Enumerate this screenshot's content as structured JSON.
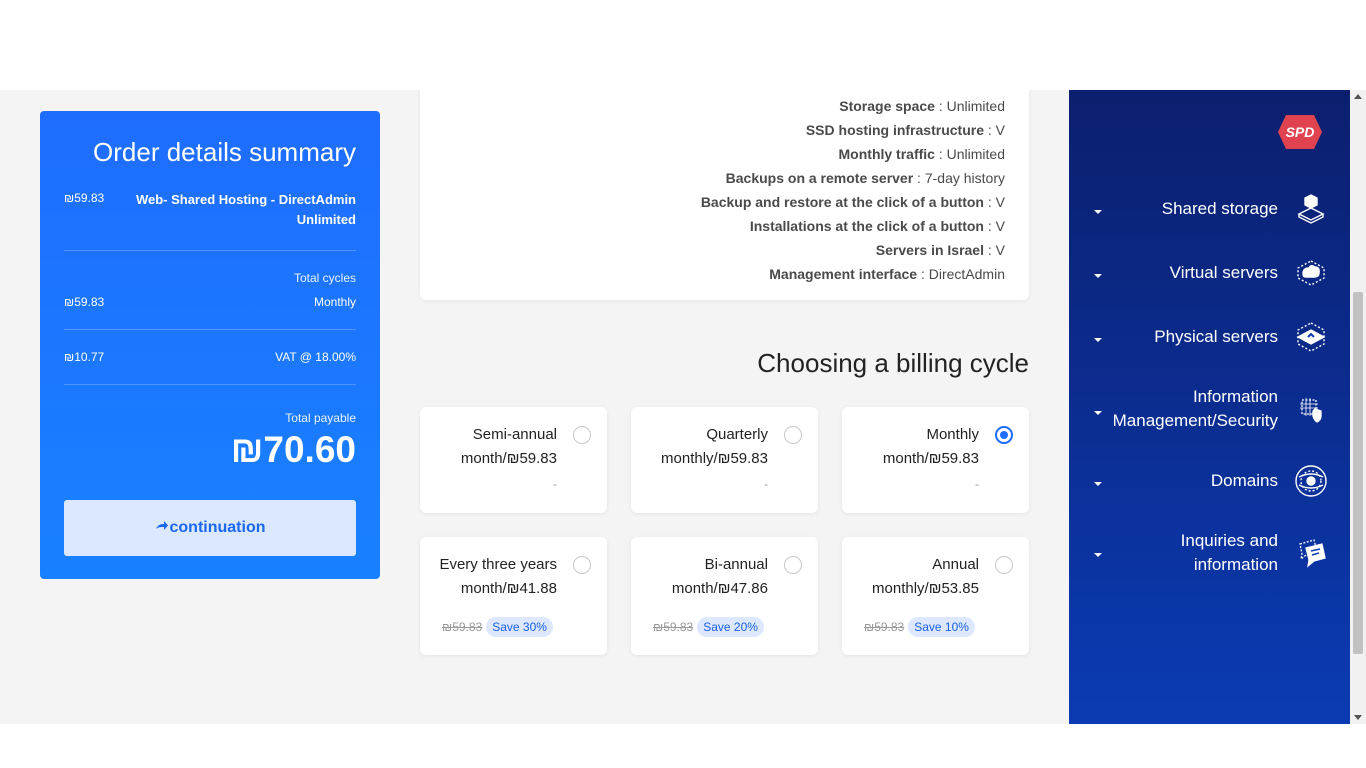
{
  "summary": {
    "title": "Order details summary",
    "item_price": "₪59.83",
    "item_name": "Web- Shared Hosting - DirectAdmin Unlimited",
    "cycles_label": "Total cycles",
    "cycle_price": "₪59.83",
    "cycle_value": "Monthly",
    "vat_amount": "₪10.77",
    "vat_label": "VAT @ 18.00%",
    "total_label": "Total payable",
    "total_value": "₪70.60",
    "continue_label": "continuation"
  },
  "features": [
    {
      "name": "Storage space",
      "value": " : Unlimited"
    },
    {
      "name": "SSD hosting infrastructure",
      "value": " : V"
    },
    {
      "name": "Monthly traffic",
      "value": " : Unlimited"
    },
    {
      "name": "Backups on a remote server",
      "value": " : 7-day history"
    },
    {
      "name": "Backup and restore at the click of a button",
      "value": " : V"
    },
    {
      "name": "Installations at the click of a button",
      "value": " : V"
    },
    {
      "name": "Servers in Israel",
      "value": " : V"
    },
    {
      "name": "Management interface",
      "value": " : DirectAdmin"
    }
  ],
  "billing": {
    "title": "Choosing a billing cycle",
    "plans": [
      {
        "name": "Semi-annual",
        "price": "month/₪59.83",
        "dash": "-",
        "selected": false
      },
      {
        "name": "Quarterly",
        "price": "monthly/₪59.83",
        "dash": "-",
        "selected": false
      },
      {
        "name": "Monthly",
        "price": "month/₪59.83",
        "dash": "-",
        "selected": true
      },
      {
        "name": "Every three years",
        "price": "month/₪41.88",
        "old": "₪59.83",
        "save": "Save 30%",
        "selected": false
      },
      {
        "name": "Bi-annual",
        "price": "month/₪47.86",
        "old": "₪59.83",
        "save": "Save 20%",
        "selected": false
      },
      {
        "name": "Annual",
        "price": "monthly/₪53.85",
        "old": "₪59.83",
        "save": "Save 10%",
        "selected": false
      }
    ]
  },
  "sidebar": {
    "logo_text": "SPD",
    "items": [
      {
        "label": "Shared storage",
        "icon": "cube-storage-icon"
      },
      {
        "label": "Virtual servers",
        "icon": "cloud-cube-icon"
      },
      {
        "label": "Physical servers",
        "icon": "server-cube-icon"
      },
      {
        "label": "Information Management/Security",
        "label_line1": "Information",
        "label_line2": "Management/Security",
        "icon": "security-chip-icon"
      },
      {
        "label": "Domains",
        "icon": "globe-icon"
      },
      {
        "label": "Inquiries and information",
        "label_line1": "Inquiries and",
        "label_line2": "information",
        "icon": "chat-bubble-icon"
      }
    ]
  },
  "colors": {
    "primary": "#1f6dff",
    "sidebar_top": "#0b1f6e",
    "sidebar_bottom": "#0b3bb3",
    "logo": "#e0434f"
  }
}
